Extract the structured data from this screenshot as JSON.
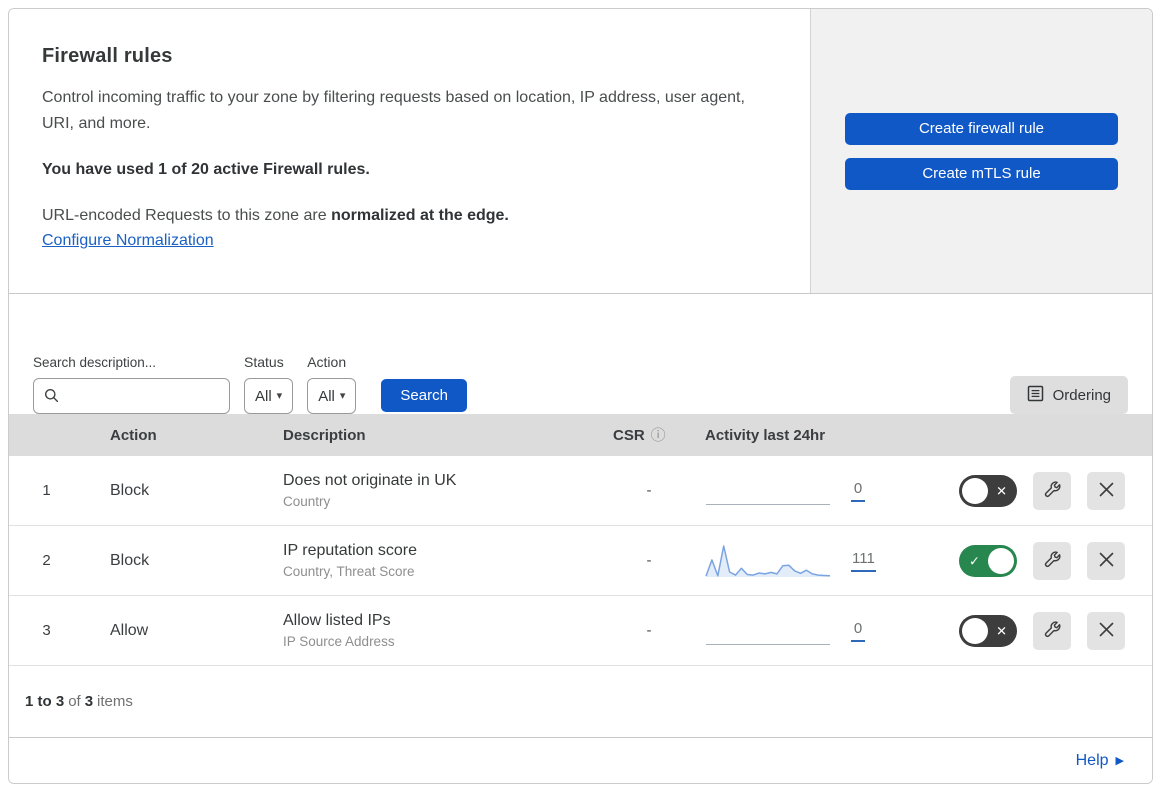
{
  "colors": {
    "accent_blue": "#1158c7",
    "toggle_on_green": "#28874e",
    "toggle_off_dark": "#3d3d3d",
    "sparkline_blue": "#7ba4e2",
    "sparkline_fill": "#e3ecf9",
    "table_header_bg": "#dcdcdc",
    "aside_bg": "#f1f1f2"
  },
  "intro": {
    "title": "Firewall rules",
    "description": "Control incoming traffic to your zone by filtering requests based on location, IP address, user agent, URI, and more.",
    "usage": "You have used 1 of 20 active Firewall rules.",
    "normalization_prefix": "URL-encoded Requests to this zone are ",
    "normalization_bold": "normalized at the edge.",
    "normalization_link": "Configure Normalization"
  },
  "aside": {
    "create_firewall_label": "Create firewall rule",
    "create_mtls_label": "Create mTLS rule"
  },
  "filters": {
    "search_label": "Search description...",
    "search_value": "",
    "status_label": "Status",
    "status_value": "All",
    "action_label": "Action",
    "action_value": "All",
    "search_button_label": "Search",
    "ordering_button_label": "Ordering"
  },
  "table": {
    "headers": {
      "action": "Action",
      "description": "Description",
      "csr": "CSR",
      "activity": "Activity last 24hr"
    },
    "rows": [
      {
        "number": "1",
        "action": "Block",
        "description": "Does not originate in UK",
        "criteria": "Country",
        "csr": "-",
        "activity_count": "0",
        "enabled": false,
        "sparkline": null
      },
      {
        "number": "2",
        "action": "Block",
        "description": "IP reputation score",
        "criteria": "Country, Threat Score",
        "csr": "-",
        "activity_count": "111",
        "enabled": true,
        "sparkline": [
          3,
          55,
          4,
          100,
          16,
          6,
          28,
          8,
          6,
          13,
          10,
          15,
          10,
          36,
          38,
          20,
          12,
          22,
          10,
          6,
          5,
          4
        ]
      },
      {
        "number": "3",
        "action": "Allow",
        "description": "Allow listed IPs",
        "criteria": "IP Source Address",
        "csr": "-",
        "activity_count": "0",
        "enabled": false,
        "sparkline": null
      }
    ]
  },
  "pagination": {
    "range": "1 to 3",
    "of_text": "of",
    "total": "3",
    "items_text": "items"
  },
  "help": {
    "label": "Help"
  },
  "icons": {
    "search": "magnifier",
    "info": "ⓘ",
    "ordering": "list-box",
    "toggle_off": "✕",
    "toggle_on": "✓",
    "wrench": "wrench",
    "delete": "x",
    "help_arrow": "▶",
    "dropdown_caret": "▾"
  }
}
